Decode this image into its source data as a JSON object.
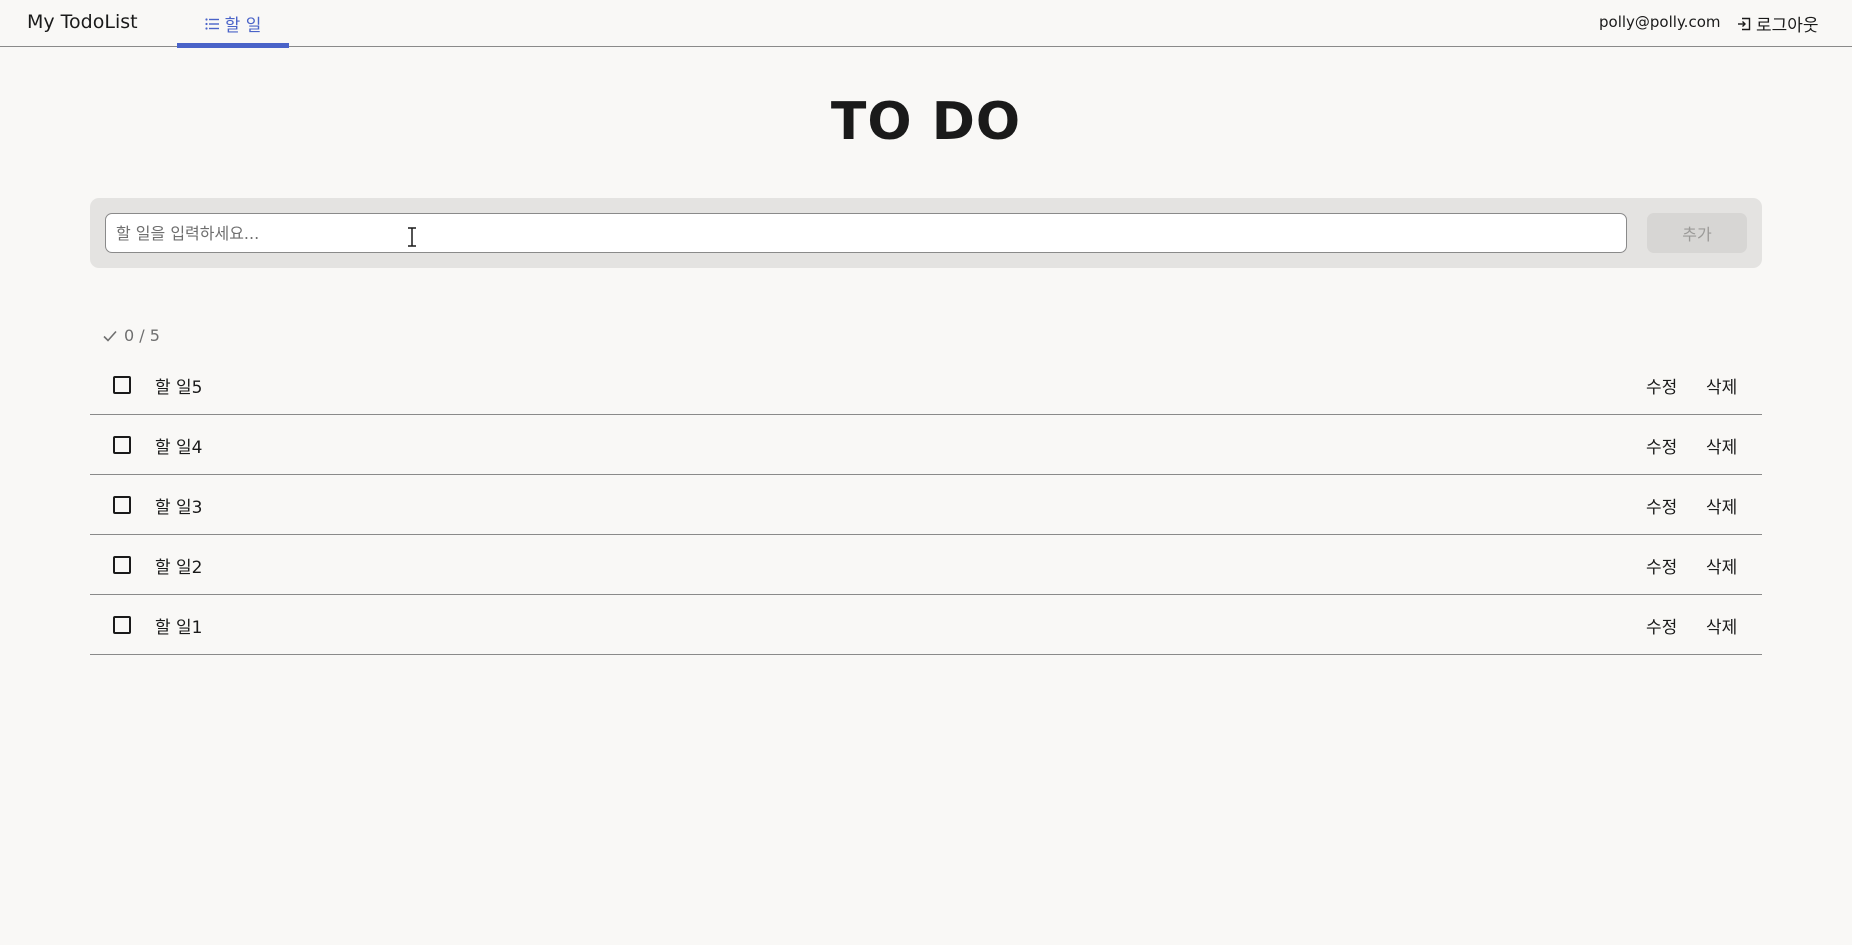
{
  "header": {
    "brand": "My TodoList",
    "nav_tab_label": "할 일",
    "user_email": "polly@polly.com",
    "logout_label": "로그아웃"
  },
  "main": {
    "title": "TO DO",
    "input_placeholder": "할 일을 입력하세요...",
    "input_value": "",
    "add_button_label": "추가",
    "progress_text": "0 / 5"
  },
  "todos": [
    {
      "text": "할 일5",
      "done": false,
      "edit_label": "수정",
      "delete_label": "삭제"
    },
    {
      "text": "할 일4",
      "done": false,
      "edit_label": "수정",
      "delete_label": "삭제"
    },
    {
      "text": "할 일3",
      "done": false,
      "edit_label": "수정",
      "delete_label": "삭제"
    },
    {
      "text": "할 일2",
      "done": false,
      "edit_label": "수정",
      "delete_label": "삭제"
    },
    {
      "text": "할 일1",
      "done": false,
      "edit_label": "수정",
      "delete_label": "삭제"
    }
  ],
  "colors": {
    "accent": "#4a63c8",
    "background": "#f9f8f6",
    "panel": "#e4e3e1",
    "muted_text": "#6f6f6f"
  },
  "icons": {
    "nav_tab": "list-icon",
    "logout": "logout-icon",
    "progress": "checkmark-icon",
    "cursor": "text-cursor-icon"
  }
}
